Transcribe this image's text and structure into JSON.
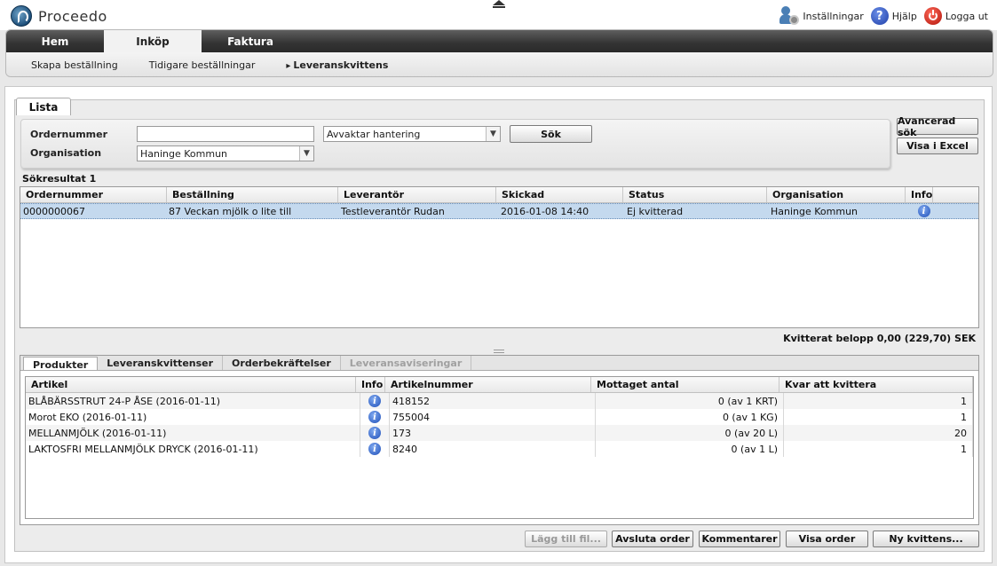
{
  "app": {
    "name": "Proceedo"
  },
  "toplinks": {
    "settings": "Inställningar",
    "help": "Hjälp",
    "logout": "Logga ut"
  },
  "nav": {
    "tabs": [
      {
        "label": "Hem"
      },
      {
        "label": "Inköp"
      },
      {
        "label": "Faktura"
      }
    ],
    "active_tab": "Inköp",
    "subnav": [
      {
        "label": "Skapa beställning"
      },
      {
        "label": "Tidigare beställningar"
      },
      {
        "label": "Leveranskvittens"
      }
    ],
    "current_subnav": "Leveranskvittens"
  },
  "panel_tab": "Lista",
  "search": {
    "ordernummer_label": "Ordernummer",
    "ordernummer_value": "",
    "status_select": "Avvaktar hantering",
    "sok_button": "Sök",
    "organisation_label": "Organisation",
    "organisation_select": "Haninge Kommun",
    "advanced_button": "Avancerad sök",
    "excel_button": "Visa i Excel"
  },
  "results": {
    "count_label": "Sökresultat 1",
    "columns": [
      "Ordernummer",
      "Beställning",
      "Leverantör",
      "Skickad",
      "Status",
      "Organisation",
      "Info"
    ],
    "rows": [
      {
        "ordernummer": "0000000067",
        "bestallning": "87 Veckan mjölk o lite till",
        "leverantor": "Testleverantör Rudan",
        "skickad": "2016-01-08 14:40",
        "status": "Ej kvitterad",
        "organisation": "Haninge Kommun"
      }
    ]
  },
  "kvitterat": "Kvitterat belopp  0,00 (229,70) SEK",
  "bottom_tabs": [
    {
      "label": "Produkter"
    },
    {
      "label": "Leveranskvittenser"
    },
    {
      "label": "Orderbekräftelser"
    },
    {
      "label": "Leveransaviseringar"
    }
  ],
  "products": {
    "columns": [
      "Artikel",
      "Info",
      "Artikelnummer",
      "Mottaget antal",
      "Kvar att kvittera"
    ],
    "rows": [
      {
        "artikel": "BLÅBÄRSSTRUT      24-P      ÅSE (2016-01-11)",
        "artikelnummer": "418152",
        "mottaget": "0 (av 1 KRT)",
        "kvar": "1"
      },
      {
        "artikel": "Morot EKO (2016-01-11)",
        "artikelnummer": "755004",
        "mottaget": "0 (av 1 KG)",
        "kvar": "1"
      },
      {
        "artikel": "MELLANMJÖLK (2016-01-11)",
        "artikelnummer": "173",
        "mottaget": "0 (av 20 L)",
        "kvar": "20"
      },
      {
        "artikel": "LAKTOSFRI MELLANMJÖLK DRYCK (2016-01-11)",
        "artikelnummer": "8240",
        "mottaget": "0 (av 1 L)",
        "kvar": "1"
      }
    ]
  },
  "footer_buttons": {
    "add_file": "Lägg till fil...",
    "close_order": "Avsluta order",
    "comments": "Kommentarer",
    "show_order": "Visa order",
    "new_receipt": "Ny kvittens..."
  }
}
